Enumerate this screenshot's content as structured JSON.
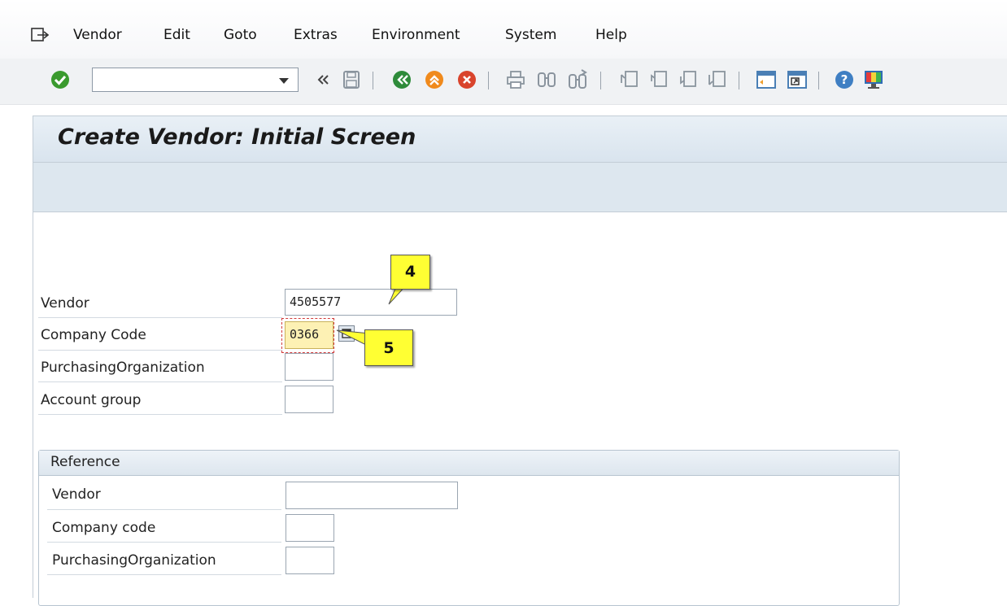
{
  "menu": {
    "items": [
      "Vendor",
      "Edit",
      "Goto",
      "Extras",
      "Environment",
      "System",
      "Help"
    ]
  },
  "toolbar": {
    "command_field_value": "",
    "icons": [
      "enter-icon",
      "command-dropdown-icon",
      "collapse-icon",
      "save-icon",
      "back-icon",
      "exit-icon",
      "cancel-icon",
      "print-icon",
      "find-icon",
      "find-next-icon",
      "first-page-icon",
      "previous-page-icon",
      "next-page-icon",
      "last-page-icon",
      "new-session-icon",
      "create-shortcut-icon",
      "help-icon",
      "customize-layout-icon"
    ]
  },
  "page": {
    "title": "Create Vendor: Initial Screen"
  },
  "form": {
    "vendor_label": "Vendor",
    "vendor_value": "4505577",
    "company_code_label": "Company Code",
    "company_code_value": "0366",
    "purch_org_label": "PurchasingOrganization",
    "purch_org_value": "",
    "account_group_label": "Account group",
    "account_group_value": ""
  },
  "reference": {
    "title": "Reference",
    "vendor_label": "Vendor",
    "vendor_value": "",
    "company_code_label": "Company code",
    "company_code_value": "",
    "purch_org_label": "PurchasingOrganization",
    "purch_org_value": ""
  },
  "callouts": {
    "step4": "4",
    "step5": "5"
  },
  "colors": {
    "callout": "#ffff33",
    "focused_field": "#fdf1b4",
    "title_bar": "#dde7ef",
    "enter_green": "#3a9a2e",
    "back_green": "#2e8b3a",
    "exit_orange": "#f08a1c",
    "cancel_red": "#d9442c"
  }
}
